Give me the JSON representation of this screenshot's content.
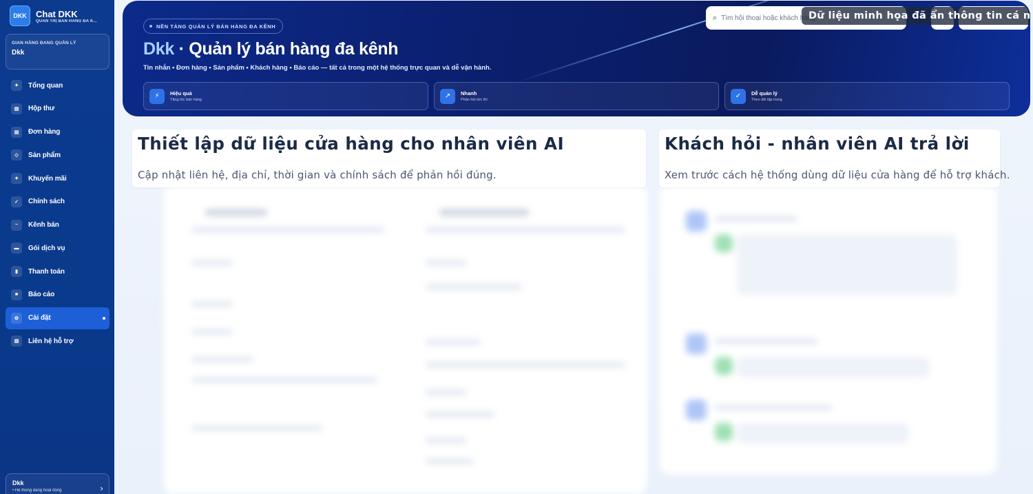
{
  "sidebar": {
    "logo": "DKK",
    "app_title": "Chat DKK",
    "app_subtitle": "QUẢN TRỊ BÁN HÀNG ĐA K...",
    "store_label": "GIAN HÀNG ĐANG QUẢN LÝ",
    "store_name": "Dkk",
    "items": [
      {
        "label": "Tổng quan",
        "icon": "sparkle-icon",
        "glyph": "✦"
      },
      {
        "label": "Hộp thư",
        "icon": "inbox-icon",
        "glyph": "▤"
      },
      {
        "label": "Đơn hàng",
        "icon": "orders-icon",
        "glyph": "▤"
      },
      {
        "label": "Sản phẩm",
        "icon": "product-icon",
        "glyph": "◇"
      },
      {
        "label": "Khuyến mãi",
        "icon": "promo-icon",
        "glyph": "✦"
      },
      {
        "label": "Chính sách",
        "icon": "check-icon",
        "glyph": "✓"
      },
      {
        "label": "Kênh bán",
        "icon": "channel-icon",
        "glyph": "~"
      },
      {
        "label": "Gói dịch vụ",
        "icon": "package-icon",
        "glyph": "▬"
      },
      {
        "label": "Thanh toán",
        "icon": "payment-icon",
        "glyph": "▮"
      },
      {
        "label": "Báo cáo",
        "icon": "report-icon",
        "glyph": "■"
      },
      {
        "label": "Cài đặt",
        "icon": "settings-icon",
        "glyph": "⚙",
        "active": true
      },
      {
        "label": "Liên hệ hỗ trợ",
        "icon": "support-icon",
        "glyph": "▤"
      }
    ],
    "footer_name": "Dkk",
    "footer_status": "• Hệ thống đang hoạt động"
  },
  "hero": {
    "pill": "NỀN TẢNG QUẢN LÝ BÁN HÀNG ĐA KÊNH",
    "title_brand": "Dkk",
    "title_rest": " · Quản lý bán hàng đa kênh",
    "description": "Tin nhắn • Đơn hàng • Sản phẩm • Khách hàng • Báo cáo — tất cả trong một hệ thống trực quan và dễ vận hành.",
    "features": [
      {
        "title": "Hiệu quả",
        "subtitle": "Tăng tốc bán hàng",
        "icon": "bolt-icon",
        "glyph": "⚡"
      },
      {
        "title": "Nhanh",
        "subtitle": "Phản hồi tức thì",
        "icon": "arrow-icon",
        "glyph": "↗"
      },
      {
        "title": "Dễ quản lý",
        "subtitle": "Theo dõi tập trung",
        "icon": "check-icon",
        "glyph": "✓"
      }
    ],
    "search_placeholder": "Tìm hội thoại hoặc khách hàng",
    "privacy_notice": "Dữ liệu minh họa đã ẩn thông tin cá nhân"
  },
  "setup_card": {
    "title": "Thiết lập dữ liệu cửa hàng cho nhân viên AI",
    "subtitle": "Cập nhật liên hệ, địa chỉ, thời gian và chính sách để phản hồi đúng."
  },
  "preview_card": {
    "title": "Khách hỏi - nhân viên AI trả lời",
    "subtitle": "Xem trước cách hệ thống dùng dữ liệu cửa hàng để hỗ trợ khách."
  },
  "colors": {
    "sidebar": "#0b3a8f",
    "hero": "#0b1f6e",
    "accent": "#1d5fd6",
    "background": "#eef3fb"
  }
}
